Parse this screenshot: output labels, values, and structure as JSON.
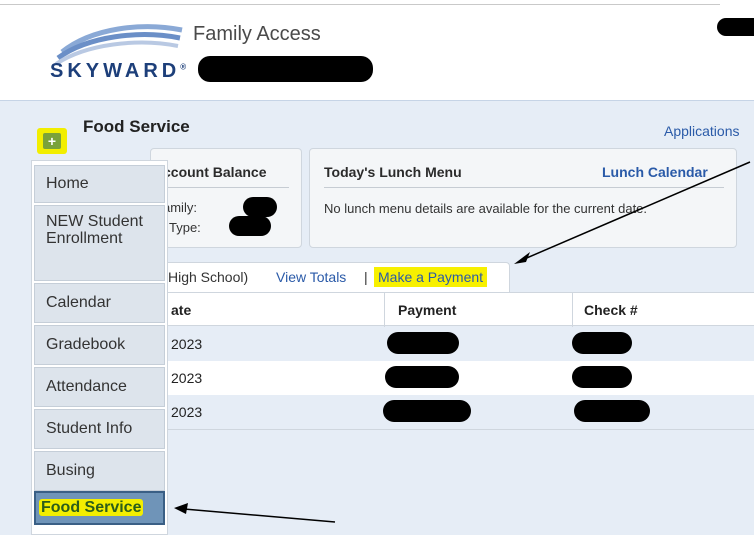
{
  "header": {
    "logo_text": "SKYWARD",
    "logo_mark": "®",
    "product_title": "Family Access"
  },
  "page": {
    "title": "Food Service",
    "applications_link": "Applications"
  },
  "balance_panel": {
    "title": "ccount Balance",
    "family_label": "amily:",
    "type_label": "Type:"
  },
  "lunch_panel": {
    "title": "Today's Lunch Menu",
    "calendar_link": "Lunch Calendar",
    "message": "No lunch menu details are available for the current date."
  },
  "tabs": {
    "school_text": "High School)",
    "view_totals": "View Totals",
    "separator": "|",
    "make_payment": "Make a Payment"
  },
  "table": {
    "headers": [
      "ate",
      "Payment",
      "Check #"
    ],
    "rows": [
      {
        "date": " 2023"
      },
      {
        "date": "2023"
      },
      {
        "date": "2023"
      }
    ]
  },
  "menu": {
    "items": [
      {
        "label": "Home"
      },
      {
        "label": "NEW Student Enrollment"
      },
      {
        "label": "Calendar"
      },
      {
        "label": "Gradebook"
      },
      {
        "label": "Attendance"
      },
      {
        "label": "Student Info"
      },
      {
        "label": "Busing"
      },
      {
        "label": "Food Service"
      }
    ],
    "add_button": "+"
  },
  "colors": {
    "highlight": "#f7f000",
    "link": "#2a5aa8",
    "active_menu": "#6f94b8"
  }
}
